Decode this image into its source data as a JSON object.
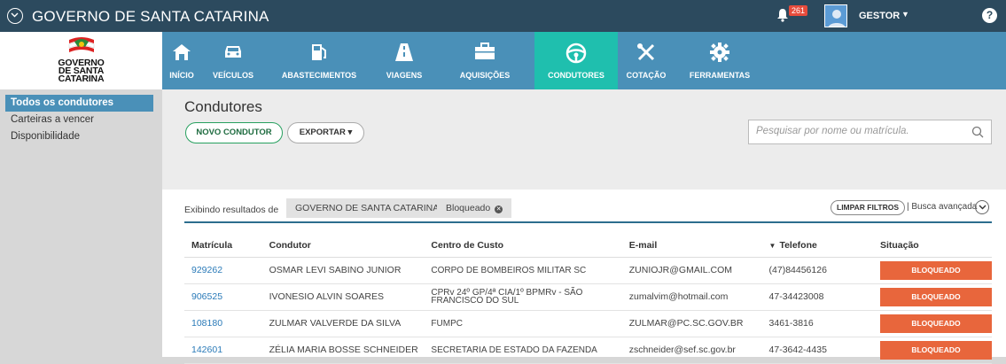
{
  "app": {
    "title": "GOVERNO DE SANTA CATARINA",
    "notifications_count": "261",
    "user_name": "GESTOR",
    "help_label": "?"
  },
  "logo": {
    "line1": "GOVERNO",
    "line2": "DE SANTA",
    "line3": "CATARINA"
  },
  "nav": {
    "items": [
      {
        "label": "INÍCIO",
        "icon": "home-icon",
        "active": false
      },
      {
        "label": "VEÍCULOS",
        "icon": "car-icon",
        "active": false
      },
      {
        "label": "ABASTECIMENTOS",
        "icon": "fuel-pump-icon",
        "active": false
      },
      {
        "label": "VIAGENS",
        "icon": "road-icon",
        "active": false
      },
      {
        "label": "AQUISIÇÕES",
        "icon": "briefcase-icon",
        "active": false
      },
      {
        "label": "CONDUTORES",
        "icon": "steering-wheel-icon",
        "active": true
      },
      {
        "label": "COTAÇÃO",
        "icon": "tools-icon",
        "active": false
      },
      {
        "label": "FERRAMENTAS",
        "icon": "gear-icon",
        "active": false
      }
    ]
  },
  "sidebar": {
    "items": [
      {
        "label": "Todos os condutores",
        "active": true
      },
      {
        "label": "Carteiras a vencer",
        "active": false
      },
      {
        "label": "Disponibilidade",
        "active": false
      }
    ]
  },
  "main": {
    "title": "Condutores",
    "new_button": "NOVO CONDUTOR",
    "export_button": "EXPORTAR ▾",
    "search_placeholder": "Pesquisar por nome ou matrícula."
  },
  "filters": {
    "label": "Exibindo resultados de",
    "chips": [
      "GOVERNO DE SANTA CATARINA",
      "Bloqueado"
    ],
    "clear_button": "LIMPAR FILTROS",
    "advanced_search": "| Busca avançada"
  },
  "table": {
    "headers": {
      "matricula": "Matrícula",
      "condutor": "Condutor",
      "centro_custo": "Centro de Custo",
      "email": "E-mail",
      "telefone": "Telefone",
      "situacao": "Situação"
    },
    "rows": [
      {
        "matricula": "929262",
        "condutor": "OSMAR LEVI SABINO JUNIOR",
        "centro_custo": "CORPO DE BOMBEIROS MILITAR SC",
        "email": "ZUNIOJR@GMAIL.COM",
        "telefone": "(47)84456126",
        "situacao": "BLOQUEADO"
      },
      {
        "matricula": "906525",
        "condutor": "IVONESIO ALVIN SOARES",
        "centro_custo": "CPRv 24º GP/4ª CIA/1º BPMRv - SÃO FRANCISCO DO SUL",
        "email": "zumalvim@hotmail.com",
        "telefone": "47-34423008",
        "situacao": "BLOQUEADO"
      },
      {
        "matricula": "108180",
        "condutor": "ZULMAR VALVERDE DA SILVA",
        "centro_custo": "FUMPC",
        "email": "ZULMAR@PC.SC.GOV.BR",
        "telefone": "3461-3816",
        "situacao": "BLOQUEADO"
      },
      {
        "matricula": "142601",
        "condutor": "ZÉLIA MARIA BOSSE SCHNEIDER",
        "centro_custo": "SECRETARIA DE ESTADO DA FAZENDA",
        "email": "zschneider@sef.sc.gov.br",
        "telefone": "47-3642-4435",
        "situacao": "BLOQUEADO"
      }
    ]
  },
  "colors": {
    "topbar": "#2c4a5e",
    "nav": "#4a90b8",
    "nav_active": "#1fbfae",
    "status_blocked": "#e8663c",
    "link": "#2a7ab8"
  }
}
